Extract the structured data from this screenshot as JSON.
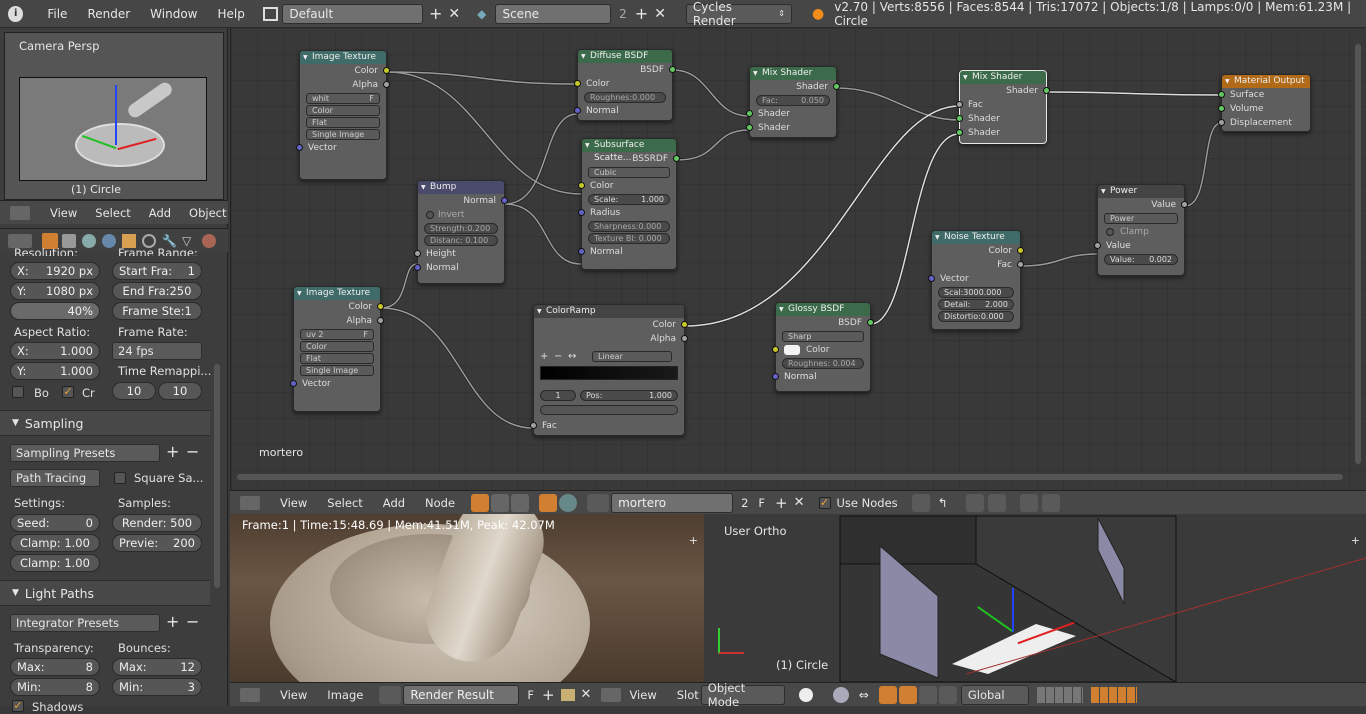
{
  "topbar": {
    "menus": [
      "File",
      "Render",
      "Window",
      "Help"
    ],
    "layout": "Default",
    "scene": "Scene",
    "scene_users": "2",
    "engine": "Cycles Render",
    "stats": "v2.70 | Verts:8556 | Faces:8544 | Tris:17072 | Objects:1/8 | Lamps:0/0 | Mem:61.23M | Circle"
  },
  "preview": {
    "label": "Camera Persp",
    "object": "(1) Circle"
  },
  "leftheader": {
    "menus": [
      "View",
      "Select",
      "Add",
      "Object"
    ]
  },
  "props": {
    "resolution_label": "Resolution:",
    "frame_range_label": "Frame Range:",
    "res_x": "X:",
    "res_x_val": "1920 px",
    "res_y": "Y:",
    "res_y_val": "1080 px",
    "res_pct": "40%",
    "start": "Start Fra:",
    "start_val": "1",
    "end": "End Fra:250",
    "frame_step": "Frame Ste:1",
    "aspect": "Aspect Ratio:",
    "framerate": "Frame Rate:",
    "asp_x": "X:",
    "asp_x_val": "1.000",
    "fps": "24 fps",
    "asp_y": "Y:",
    "asp_y_val": "1.000",
    "remap": "Time Remappi...",
    "bo": "Bo",
    "cr": "Cr",
    "remap_a": "10",
    "remap_b": "10",
    "sampling": "Sampling",
    "sampling_presets": "Sampling Presets",
    "path_tracing": "Path Tracing",
    "square": "Square Sa...",
    "settings": "Settings:",
    "samples": "Samples:",
    "seed": "Seed:",
    "seed_val": "0",
    "render_s": "Render: 500",
    "clamp1": "Clamp: 1.00",
    "preview_s": "Previe:",
    "preview_val": "200",
    "clamp2": "Clamp: 1.00",
    "light_paths": "Light Paths",
    "integrator": "Integrator Presets",
    "transparency": "Transparency:",
    "bounces": "Bounces:",
    "tmax": "Max:",
    "tmax_v": "8",
    "tmin": "Min:",
    "tmin_v": "8",
    "bmax": "Max:",
    "bmax_v": "12",
    "bmin": "Min:",
    "bmin_v": "3",
    "shadows": "Shadows"
  },
  "nodes": {
    "img1": {
      "title": "Image Texture",
      "color": "Color",
      "alpha": "Alpha",
      "img": "whit",
      "f": "F",
      "o1": "Color",
      "o2": "Flat",
      "o3": "Single Image",
      "vec": "Vector"
    },
    "diffuse": {
      "title": "Diffuse BSDF",
      "bsdf": "BSDF",
      "color": "Color",
      "rough": "Roughnes:0.000",
      "normal": "Normal"
    },
    "mix1": {
      "title": "Mix Shader",
      "shader": "Shader",
      "fac": "Fac:",
      "facv": "0.050",
      "s1": "Shader",
      "s2": "Shader"
    },
    "mix2": {
      "title": "Mix Shader",
      "shader": "Shader",
      "fac": "Fac",
      "s1": "Shader",
      "s2": "Shader"
    },
    "matout": {
      "title": "Material Output",
      "surface": "Surface",
      "volume": "Volume",
      "disp": "Displacement"
    },
    "sss": {
      "title": "Subsurface Scatte...",
      "bssrdf": "BSSRDF",
      "cubic": "Cubic",
      "color": "Color",
      "scale": "Scale:",
      "scalev": "1.000",
      "radius": "Radius",
      "sharp": "Sharpness:0.000",
      "texbl": "Texture Bl: 0.000",
      "normal": "Normal"
    },
    "bump": {
      "title": "Bump",
      "normal": "Normal",
      "invert": "Invert",
      "strength": "Strength:0.200",
      "distance": "Distanc: 0.100",
      "height": "Height",
      "normal_in": "Normal"
    },
    "img2": {
      "title": "Image Texture",
      "color": "Color",
      "alpha": "Alpha",
      "img": "uv 2",
      "f": "F",
      "o1": "Color",
      "o2": "Flat",
      "o3": "Single Image",
      "vec": "Vector"
    },
    "ramp": {
      "title": "ColorRamp",
      "color": "Color",
      "alpha": "Alpha",
      "interp": "Linear",
      "idx": "1",
      "pos": "Pos:",
      "posv": "1.000",
      "fac": "Fac"
    },
    "glossy": {
      "title": "Glossy BSDF",
      "bsdf": "BSDF",
      "sharp": "Sharp",
      "color": "Color",
      "rough": "Roughnes: 0.004",
      "normal": "Normal"
    },
    "noise": {
      "title": "Noise Texture",
      "color": "Color",
      "fac": "Fac",
      "vector": "Vector",
      "scale": "Scal:3000.000",
      "detail": "Detail:",
      "detailv": "2.000",
      "distortion": "Distortio:0.000"
    },
    "power": {
      "title": "Power",
      "value": "Value",
      "op": "Power",
      "clamp": "Clamp",
      "vin": "Value:",
      "vinv": "0.002"
    }
  },
  "material_label": "mortero",
  "nodebar": {
    "menus": [
      "View",
      "Select",
      "Add",
      "Node"
    ],
    "material": "mortero",
    "users": "2",
    "f": "F",
    "use_nodes": "Use Nodes"
  },
  "render": {
    "info": "Frame:1 | Time:15:48.69 | Mem:41.51M, Peak: 42.07M"
  },
  "view3d": {
    "label": "User Ortho",
    "object": "(1) Circle"
  },
  "bottombar": {
    "view": "View",
    "image": "Image",
    "result": "Render Result",
    "f": "F",
    "view2": "View",
    "slot": "Slot",
    "mode": "Object Mode",
    "global": "Global"
  }
}
